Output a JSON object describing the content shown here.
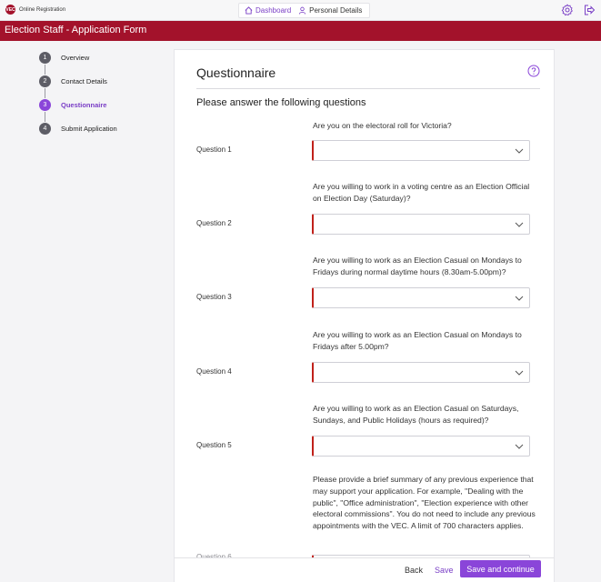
{
  "app": {
    "logo_badge": "VEC",
    "logo_text": "Online Registration"
  },
  "nav": {
    "dashboard": "Dashboard",
    "personal_details": "Personal Details"
  },
  "banner": {
    "title": "Election Staff - Application Form"
  },
  "steps": [
    {
      "num": "1",
      "label": "Overview"
    },
    {
      "num": "2",
      "label": "Contact Details"
    },
    {
      "num": "3",
      "label": "Questionnaire"
    },
    {
      "num": "4",
      "label": "Submit Application"
    }
  ],
  "card": {
    "title": "Questionnaire",
    "subtitle": "Please answer the following questions"
  },
  "questions": [
    {
      "label": "Question 1",
      "text": "Are you on the electoral roll for Victoria?",
      "value": ""
    },
    {
      "label": "Question 2",
      "text": "Are you willing to work in a voting centre as an Election Official on Election Day (Saturday)?",
      "value": ""
    },
    {
      "label": "Question 3",
      "text": "Are you willing to work as an Election Casual on Mondays to Fridays during normal daytime hours (8.30am-5.00pm)?",
      "value": ""
    },
    {
      "label": "Question 4",
      "text": "Are you willing to work as an Election Casual on Mondays to Fridays after 5.00pm?",
      "value": ""
    },
    {
      "label": "Question 5",
      "text": "Are you willing to work as an Election Casual on Saturdays, Sundays, and Public Holidays (hours as required)?",
      "value": ""
    },
    {
      "label": "Question 6",
      "text": "Please provide a brief summary of any previous experience that may support your application. For example, \"Dealing with the public\", \"Office administration\", \"Election experience with other electoral commissions\". You do not need to include any previous appointments with the VEC. A limit of 700 characters applies.",
      "value": ""
    }
  ],
  "footer": {
    "back": "Back",
    "save": "Save",
    "save_continue": "Save and continue"
  },
  "colors": {
    "brand_red": "#a3122b",
    "accent_purple": "#8a45d9",
    "required_border": "#c0211a"
  }
}
